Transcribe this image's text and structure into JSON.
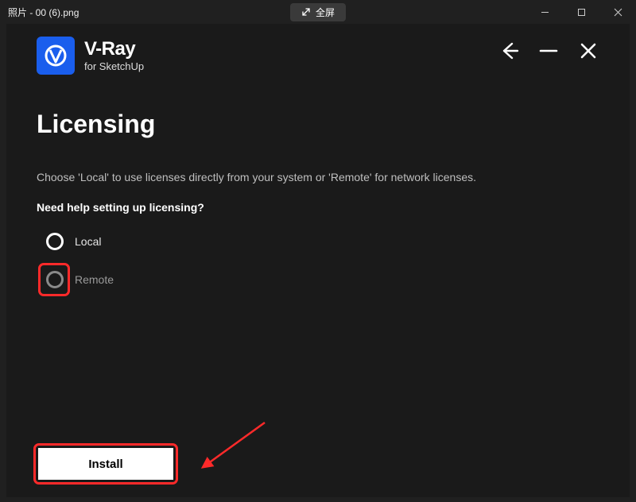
{
  "titlebar": {
    "title": "照片 - 00 (6).png",
    "fullscreen_label": "全屏"
  },
  "brand": {
    "line1": "V-Ray",
    "line2": "for SketchUp"
  },
  "page": {
    "title": "Licensing",
    "description": "Choose 'Local' to use licenses directly from your system or 'Remote' for network licenses.",
    "help_link": "Need help setting up licensing?"
  },
  "options": {
    "local": "Local",
    "remote": "Remote"
  },
  "actions": {
    "install": "Install"
  }
}
